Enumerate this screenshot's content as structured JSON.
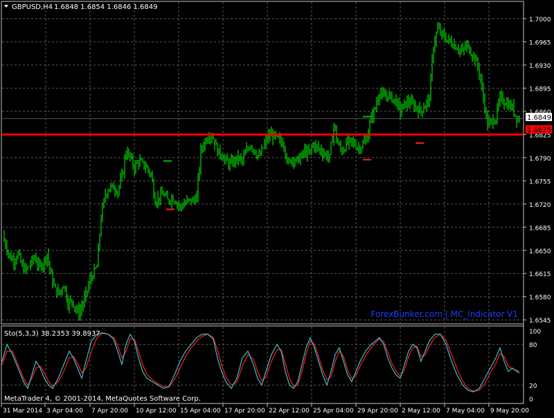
{
  "header": {
    "symbol_label": "GBPUSD,H4",
    "ohlc": "1.6848 1.6854 1.6846 1.6849"
  },
  "indicator": {
    "label": "Sto(5,3,3) 38.2353 39.8937",
    "levels": [
      "100",
      "80",
      "20",
      "0"
    ]
  },
  "watermark": "ForexBunker.com | MC_Indicator V1",
  "copyright": "MetaTrader 4, © 2001-2014, MetaQuotes Software Corp.",
  "price_badges": {
    "current": "1.6849",
    "line": "1.6825"
  },
  "colors": {
    "background": "#000000",
    "candle": "#00ff00",
    "grid": "#5a5a5a",
    "hline": "#ff0000",
    "stoch_main": "#40c0d0",
    "stoch_signal": "#ff2020",
    "watermark": "#1e3cff"
  },
  "chart_data": {
    "type": "candlestick",
    "y_ticks": [
      "1.7000",
      "1.6965",
      "1.6930",
      "1.6895",
      "1.6860",
      "1.6825",
      "1.6790",
      "1.6755",
      "1.6720",
      "1.6685",
      "1.6650",
      "1.6615",
      "1.6580",
      "1.6545"
    ],
    "x_ticks": [
      "31 Mar 2014",
      "3 Apr 04:00",
      "7 Apr 20:00",
      "10 Apr 12:00",
      "15 Apr 04:00",
      "17 Apr 20:00",
      "22 Apr 12:00",
      "25 Apr 04:00",
      "29 Apr 20:00",
      "2 May 12:00",
      "7 May 04:00",
      "9 May 20:00"
    ],
    "ylim": [
      1.654,
      1.7025
    ],
    "hline": 1.6825,
    "grid": true,
    "close_path": [
      [
        0,
        1.6675
      ],
      [
        8,
        1.666
      ],
      [
        14,
        1.664
      ],
      [
        20,
        1.6635
      ],
      [
        26,
        1.6645
      ],
      [
        32,
        1.6625
      ],
      [
        38,
        1.662
      ],
      [
        44,
        1.663
      ],
      [
        50,
        1.664
      ],
      [
        56,
        1.6625
      ],
      [
        62,
        1.663
      ],
      [
        68,
        1.6645
      ],
      [
        74,
        1.661
      ],
      [
        80,
        1.659
      ],
      [
        86,
        1.6585
      ],
      [
        92,
        1.66
      ],
      [
        98,
        1.657
      ],
      [
        104,
        1.6575
      ],
      [
        110,
        1.656
      ],
      [
        114,
        1.6555
      ],
      [
        120,
        1.657
      ],
      [
        126,
        1.659
      ],
      [
        132,
        1.661
      ],
      [
        140,
        1.6625
      ],
      [
        146,
        1.67
      ],
      [
        152,
        1.6735
      ],
      [
        158,
        1.6745
      ],
      [
        164,
        1.6745
      ],
      [
        170,
        1.674
      ],
      [
        176,
        1.676
      ],
      [
        182,
        1.68
      ],
      [
        188,
        1.679
      ],
      [
        194,
        1.6775
      ],
      [
        200,
        1.6785
      ],
      [
        206,
        1.678
      ],
      [
        212,
        1.6775
      ],
      [
        218,
        1.6765
      ],
      [
        224,
        1.6725
      ],
      [
        230,
        1.673
      ],
      [
        236,
        1.6735
      ],
      [
        242,
        1.6725
      ],
      [
        248,
        1.673
      ],
      [
        254,
        1.6725
      ],
      [
        260,
        1.6715
      ],
      [
        266,
        1.672
      ],
      [
        272,
        1.6725
      ],
      [
        278,
        1.6725
      ],
      [
        284,
        1.673
      ],
      [
        290,
        1.68
      ],
      [
        296,
        1.6815
      ],
      [
        302,
        1.6825
      ],
      [
        308,
        1.682
      ],
      [
        314,
        1.68
      ],
      [
        320,
        1.6795
      ],
      [
        326,
        1.6785
      ],
      [
        332,
        1.678
      ],
      [
        338,
        1.6785
      ],
      [
        344,
        1.679
      ],
      [
        350,
        1.6785
      ],
      [
        356,
        1.68
      ],
      [
        362,
        1.681
      ],
      [
        368,
        1.68
      ],
      [
        374,
        1.679
      ],
      [
        380,
        1.6805
      ],
      [
        386,
        1.682
      ],
      [
        392,
        1.6825
      ],
      [
        398,
        1.682
      ],
      [
        404,
        1.6815
      ],
      [
        410,
        1.681
      ],
      [
        416,
        1.678
      ],
      [
        422,
        1.679
      ],
      [
        428,
        1.6785
      ],
      [
        434,
        1.679
      ],
      [
        440,
        1.68
      ],
      [
        446,
        1.6795
      ],
      [
        452,
        1.681
      ],
      [
        458,
        1.6805
      ],
      [
        464,
        1.68
      ],
      [
        470,
        1.6795
      ],
      [
        476,
        1.679
      ],
      [
        482,
        1.684
      ],
      [
        488,
        1.681
      ],
      [
        494,
        1.68
      ],
      [
        500,
        1.681
      ],
      [
        506,
        1.6815
      ],
      [
        512,
        1.681
      ],
      [
        518,
        1.6805
      ],
      [
        524,
        1.681
      ],
      [
        530,
        1.682
      ],
      [
        536,
        1.685
      ],
      [
        542,
        1.6865
      ],
      [
        548,
        1.689
      ],
      [
        554,
        1.688
      ],
      [
        560,
        1.6885
      ],
      [
        566,
        1.688
      ],
      [
        572,
        1.6875
      ],
      [
        578,
        1.686
      ],
      [
        584,
        1.687
      ],
      [
        590,
        1.6875
      ],
      [
        596,
        1.687
      ],
      [
        602,
        1.6865
      ],
      [
        608,
        1.686
      ],
      [
        614,
        1.687
      ],
      [
        620,
        1.688
      ],
      [
        626,
        1.696
      ],
      [
        632,
        1.6985
      ],
      [
        638,
        1.6975
      ],
      [
        644,
        1.697
      ],
      [
        650,
        1.6965
      ],
      [
        656,
        1.696
      ],
      [
        662,
        1.6955
      ],
      [
        668,
        1.695
      ],
      [
        674,
        1.696
      ],
      [
        680,
        1.695
      ],
      [
        686,
        1.694
      ],
      [
        692,
        1.692
      ],
      [
        698,
        1.688
      ],
      [
        704,
        1.684
      ],
      [
        710,
        1.6845
      ],
      [
        716,
        1.685
      ],
      [
        722,
        1.688
      ],
      [
        728,
        1.6875
      ],
      [
        734,
        1.687
      ],
      [
        740,
        1.6865
      ],
      [
        746,
        1.685
      ],
      [
        750,
        1.6849
      ]
    ],
    "markers": [
      {
        "index": 236,
        "price": 1.6785,
        "color": "#00c000"
      },
      {
        "index": 240,
        "price": 1.6712,
        "color": "#ff2020"
      },
      {
        "index": 524,
        "price": 1.6787,
        "color": "#ff2020"
      },
      {
        "index": 524,
        "price": 1.6852,
        "color": "#00c000"
      },
      {
        "index": 600,
        "price": 1.6812,
        "color": "#ff2020"
      }
    ],
    "stochastic": {
      "main": [
        [
          3,
          55
        ],
        [
          10,
          80
        ],
        [
          18,
          65
        ],
        [
          26,
          45
        ],
        [
          34,
          25
        ],
        [
          40,
          15
        ],
        [
          46,
          35
        ],
        [
          52,
          55
        ],
        [
          58,
          45
        ],
        [
          64,
          30
        ],
        [
          70,
          20
        ],
        [
          76,
          15
        ],
        [
          84,
          30
        ],
        [
          92,
          50
        ],
        [
          100,
          70
        ],
        [
          106,
          60
        ],
        [
          112,
          45
        ],
        [
          118,
          30
        ],
        [
          124,
          55
        ],
        [
          132,
          85
        ],
        [
          140,
          95
        ],
        [
          148,
          97
        ],
        [
          156,
          95
        ],
        [
          164,
          88
        ],
        [
          170,
          70
        ],
        [
          176,
          50
        ],
        [
          182,
          80
        ],
        [
          188,
          95
        ],
        [
          194,
          85
        ],
        [
          200,
          60
        ],
        [
          206,
          40
        ],
        [
          212,
          30
        ],
        [
          220,
          25
        ],
        [
          228,
          20
        ],
        [
          236,
          15
        ],
        [
          244,
          18
        ],
        [
          252,
          35
        ],
        [
          260,
          55
        ],
        [
          268,
          70
        ],
        [
          276,
          80
        ],
        [
          284,
          90
        ],
        [
          292,
          95
        ],
        [
          300,
          95
        ],
        [
          308,
          88
        ],
        [
          314,
          60
        ],
        [
          320,
          40
        ],
        [
          326,
          25
        ],
        [
          334,
          15
        ],
        [
          342,
          30
        ],
        [
          350,
          60
        ],
        [
          358,
          70
        ],
        [
          366,
          50
        ],
        [
          372,
          30
        ],
        [
          378,
          20
        ],
        [
          384,
          40
        ],
        [
          392,
          65
        ],
        [
          400,
          80
        ],
        [
          406,
          70
        ],
        [
          412,
          40
        ],
        [
          418,
          20
        ],
        [
          424,
          15
        ],
        [
          430,
          25
        ],
        [
          436,
          50
        ],
        [
          442,
          75
        ],
        [
          448,
          90
        ],
        [
          454,
          75
        ],
        [
          460,
          55
        ],
        [
          466,
          35
        ],
        [
          472,
          20
        ],
        [
          478,
          40
        ],
        [
          484,
          65
        ],
        [
          490,
          75
        ],
        [
          496,
          55
        ],
        [
          502,
          35
        ],
        [
          508,
          25
        ],
        [
          514,
          40
        ],
        [
          520,
          55
        ],
        [
          528,
          70
        ],
        [
          536,
          80
        ],
        [
          542,
          85
        ],
        [
          548,
          90
        ],
        [
          554,
          80
        ],
        [
          560,
          60
        ],
        [
          566,
          45
        ],
        [
          572,
          35
        ],
        [
          578,
          30
        ],
        [
          584,
          50
        ],
        [
          590,
          70
        ],
        [
          596,
          80
        ],
        [
          602,
          75
        ],
        [
          608,
          55
        ],
        [
          614,
          70
        ],
        [
          620,
          85
        ],
        [
          628,
          95
        ],
        [
          636,
          95
        ],
        [
          644,
          80
        ],
        [
          652,
          55
        ],
        [
          660,
          35
        ],
        [
          668,
          20
        ],
        [
          676,
          12
        ],
        [
          684,
          10
        ],
        [
          692,
          15
        ],
        [
          700,
          30
        ],
        [
          708,
          45
        ],
        [
          716,
          60
        ],
        [
          722,
          75
        ],
        [
          728,
          55
        ],
        [
          734,
          40
        ],
        [
          740,
          45
        ],
        [
          746,
          40
        ],
        [
          750,
          38
        ]
      ],
      "signal": [
        [
          3,
          50
        ],
        [
          10,
          70
        ],
        [
          18,
          70
        ],
        [
          26,
          50
        ],
        [
          34,
          30
        ],
        [
          40,
          20
        ],
        [
          46,
          30
        ],
        [
          52,
          45
        ],
        [
          58,
          48
        ],
        [
          64,
          38
        ],
        [
          70,
          25
        ],
        [
          76,
          18
        ],
        [
          84,
          25
        ],
        [
          92,
          40
        ],
        [
          100,
          60
        ],
        [
          106,
          62
        ],
        [
          112,
          52
        ],
        [
          118,
          38
        ],
        [
          124,
          45
        ],
        [
          132,
          70
        ],
        [
          140,
          90
        ],
        [
          148,
          96
        ],
        [
          156,
          95
        ],
        [
          164,
          90
        ],
        [
          170,
          78
        ],
        [
          176,
          60
        ],
        [
          182,
          70
        ],
        [
          188,
          88
        ],
        [
          194,
          88
        ],
        [
          200,
          70
        ],
        [
          206,
          50
        ],
        [
          212,
          36
        ],
        [
          220,
          28
        ],
        [
          228,
          22
        ],
        [
          236,
          18
        ],
        [
          244,
          17
        ],
        [
          252,
          28
        ],
        [
          260,
          45
        ],
        [
          268,
          62
        ],
        [
          276,
          75
        ],
        [
          284,
          85
        ],
        [
          292,
          92
        ],
        [
          300,
          95
        ],
        [
          308,
          90
        ],
        [
          314,
          72
        ],
        [
          320,
          50
        ],
        [
          326,
          32
        ],
        [
          334,
          20
        ],
        [
          342,
          24
        ],
        [
          350,
          48
        ],
        [
          358,
          65
        ],
        [
          366,
          58
        ],
        [
          372,
          40
        ],
        [
          378,
          26
        ],
        [
          384,
          32
        ],
        [
          392,
          55
        ],
        [
          400,
          72
        ],
        [
          406,
          72
        ],
        [
          412,
          52
        ],
        [
          418,
          30
        ],
        [
          424,
          18
        ],
        [
          430,
          20
        ],
        [
          436,
          40
        ],
        [
          442,
          65
        ],
        [
          448,
          85
        ],
        [
          454,
          80
        ],
        [
          460,
          62
        ],
        [
          466,
          42
        ],
        [
          472,
          28
        ],
        [
          478,
          32
        ],
        [
          484,
          55
        ],
        [
          490,
          70
        ],
        [
          496,
          62
        ],
        [
          502,
          42
        ],
        [
          508,
          30
        ],
        [
          514,
          34
        ],
        [
          520,
          48
        ],
        [
          528,
          63
        ],
        [
          536,
          75
        ],
        [
          542,
          82
        ],
        [
          548,
          88
        ],
        [
          554,
          84
        ],
        [
          560,
          68
        ],
        [
          566,
          52
        ],
        [
          572,
          40
        ],
        [
          578,
          33
        ],
        [
          584,
          42
        ],
        [
          590,
          62
        ],
        [
          596,
          75
        ],
        [
          602,
          77
        ],
        [
          608,
          62
        ],
        [
          614,
          64
        ],
        [
          620,
          78
        ],
        [
          628,
          90
        ],
        [
          636,
          95
        ],
        [
          644,
          86
        ],
        [
          652,
          65
        ],
        [
          660,
          44
        ],
        [
          668,
          26
        ],
        [
          676,
          15
        ],
        [
          684,
          11
        ],
        [
          692,
          12
        ],
        [
          700,
          22
        ],
        [
          708,
          38
        ],
        [
          716,
          52
        ],
        [
          722,
          66
        ],
        [
          728,
          62
        ],
        [
          734,
          48
        ],
        [
          740,
          44
        ],
        [
          746,
          42
        ],
        [
          750,
          40
        ]
      ]
    }
  }
}
